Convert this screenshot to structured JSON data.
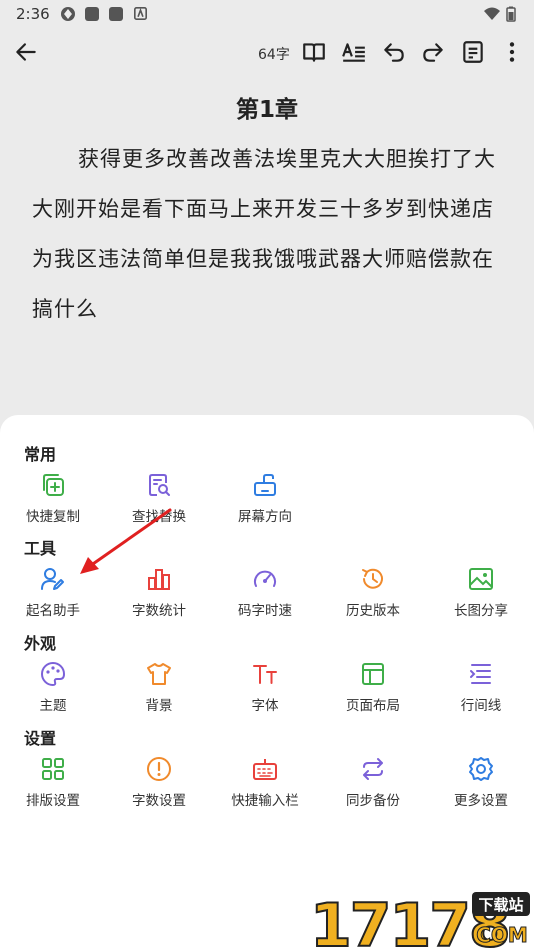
{
  "status": {
    "time": "2:36"
  },
  "toolbar": {
    "word_count": "64字"
  },
  "chapter": {
    "title": "第1章",
    "text": "获得更多改善改善法埃里克大大胆挨打了大大刚开始是看下面马上来开发三十多岁到快递店为我区违法简单但是我我饿哦武器大师赔偿款在搞什么"
  },
  "sections": [
    {
      "title": "常用",
      "items": [
        {
          "label": "快捷复制",
          "icon": "copy-plus-icon"
        },
        {
          "label": "查找替换",
          "icon": "find-replace-icon"
        },
        {
          "label": "屏幕方向",
          "icon": "screen-rotate-icon"
        }
      ]
    },
    {
      "title": "工具",
      "items": [
        {
          "label": "起名助手",
          "icon": "naming-assistant-icon"
        },
        {
          "label": "字数统计",
          "icon": "bar-chart-icon"
        },
        {
          "label": "码字时速",
          "icon": "speedometer-icon"
        },
        {
          "label": "历史版本",
          "icon": "history-icon"
        },
        {
          "label": "长图分享",
          "icon": "image-icon"
        }
      ]
    },
    {
      "title": "外观",
      "items": [
        {
          "label": "主题",
          "icon": "palette-icon"
        },
        {
          "label": "背景",
          "icon": "shirt-icon"
        },
        {
          "label": "字体",
          "icon": "font-icon"
        },
        {
          "label": "页面布局",
          "icon": "layout-icon"
        },
        {
          "label": "行间线",
          "icon": "line-spacing-icon"
        }
      ]
    },
    {
      "title": "设置",
      "items": [
        {
          "label": "排版设置",
          "icon": "grid-icon"
        },
        {
          "label": "字数设置",
          "icon": "alert-circle-icon"
        },
        {
          "label": "快捷输入栏",
          "icon": "keyboard-icon"
        },
        {
          "label": "同步备份",
          "icon": "sync-icon"
        },
        {
          "label": "更多设置",
          "icon": "gear-icon"
        }
      ]
    }
  ],
  "colors": {
    "green": "#3fae49",
    "purple": "#7b61d9",
    "blue": "#2f7de1",
    "red": "#e8413c",
    "orange": "#f08a2c",
    "annotation": "#e02020"
  },
  "watermark": {
    "text": "17178",
    "badge": "下载站",
    "domain": "COM"
  }
}
